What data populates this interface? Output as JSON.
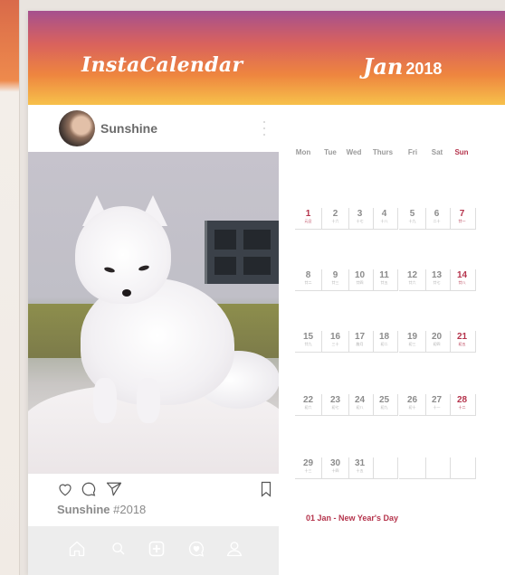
{
  "app": {
    "title": "InstaCalendar",
    "month": "Jan",
    "year": "2018"
  },
  "post": {
    "username": "Sunshine",
    "caption_user": "Sunshine",
    "caption_tag": "#2018",
    "photo_subject": "arctic-fox",
    "icons": [
      "heart-icon",
      "comment-icon",
      "send-icon",
      "bookmark-icon",
      "more-icon"
    ]
  },
  "tabbar": {
    "icons": [
      "home-icon",
      "search-icon",
      "add-post-icon",
      "activity-icon",
      "profile-icon"
    ]
  },
  "calendar": {
    "weekdays": [
      "Mon",
      "Tue",
      "Wed",
      "Thurs",
      "Fri",
      "Sat",
      "Sun"
    ],
    "weeks": [
      [
        {
          "day": "1",
          "lunar": "元旦",
          "holiday": true
        },
        {
          "day": "2",
          "lunar": "十六"
        },
        {
          "day": "3",
          "lunar": "十七"
        },
        {
          "day": "4",
          "lunar": "十八"
        },
        {
          "day": "5",
          "lunar": "十九"
        },
        {
          "day": "6",
          "lunar": "二十"
        },
        {
          "day": "7",
          "lunar": "廿一",
          "sunday": true
        }
      ],
      [
        {
          "day": "8",
          "lunar": "廿二"
        },
        {
          "day": "9",
          "lunar": "廿三"
        },
        {
          "day": "10",
          "lunar": "廿四"
        },
        {
          "day": "11",
          "lunar": "廿五"
        },
        {
          "day": "12",
          "lunar": "廿六"
        },
        {
          "day": "13",
          "lunar": "廿七"
        },
        {
          "day": "14",
          "lunar": "廿八",
          "sunday": true
        }
      ],
      [
        {
          "day": "15",
          "lunar": "廿九"
        },
        {
          "day": "16",
          "lunar": "三十"
        },
        {
          "day": "17",
          "lunar": "腊月"
        },
        {
          "day": "18",
          "lunar": "初二"
        },
        {
          "day": "19",
          "lunar": "初三"
        },
        {
          "day": "20",
          "lunar": "初四"
        },
        {
          "day": "21",
          "lunar": "初五",
          "sunday": true
        }
      ],
      [
        {
          "day": "22",
          "lunar": "初六"
        },
        {
          "day": "23",
          "lunar": "初七"
        },
        {
          "day": "24",
          "lunar": "初八"
        },
        {
          "day": "25",
          "lunar": "初九"
        },
        {
          "day": "26",
          "lunar": "初十"
        },
        {
          "day": "27",
          "lunar": "十一"
        },
        {
          "day": "28",
          "lunar": "十二",
          "sunday": true
        }
      ],
      [
        {
          "day": "29",
          "lunar": "十三"
        },
        {
          "day": "30",
          "lunar": "十四"
        },
        {
          "day": "31",
          "lunar": "十五"
        },
        {
          "day": "",
          "lunar": ""
        },
        {
          "day": "",
          "lunar": ""
        },
        {
          "day": "",
          "lunar": ""
        },
        {
          "day": "",
          "lunar": ""
        }
      ]
    ],
    "holiday_note": "01 Jan - New Year's Day"
  },
  "colors": {
    "accent": "#b5344c",
    "header_top": "#a5508e",
    "header_bottom": "#f7c14b",
    "text_gray": "#8c8c8c"
  }
}
